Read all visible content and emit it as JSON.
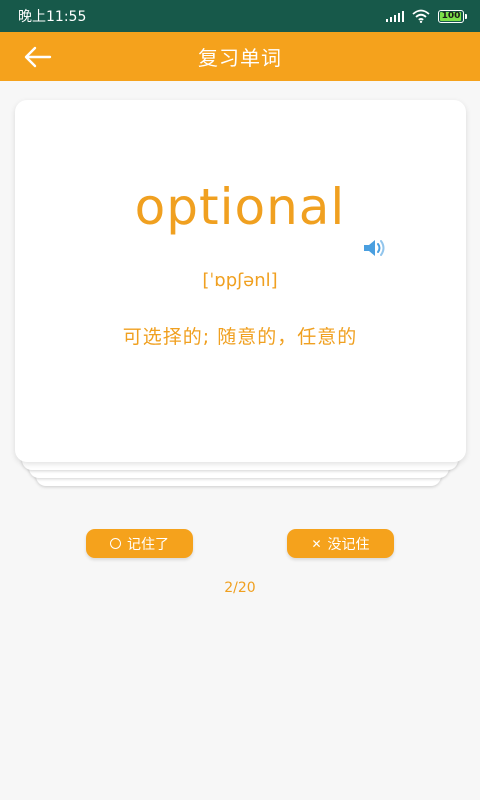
{
  "status_bar": {
    "time": "晚上11:55",
    "battery": "100",
    "signal_icon": "signal-bars-icon",
    "wifi_icon": "wifi-icon"
  },
  "header": {
    "title": "复习单词",
    "back_icon": "arrow-left-icon"
  },
  "card": {
    "word": "optional",
    "phonetic": "[ˈɒpʃənl]",
    "meaning": "可选择的; 随意的，任意的",
    "speaker_icon": "speaker-icon"
  },
  "actions": {
    "remembered_label": "记住了",
    "forgot_label": "没记住"
  },
  "progress": "2/20",
  "colors": {
    "accent": "#f5a21c",
    "status_bar": "#17594a",
    "text_accent": "#f0a020"
  }
}
